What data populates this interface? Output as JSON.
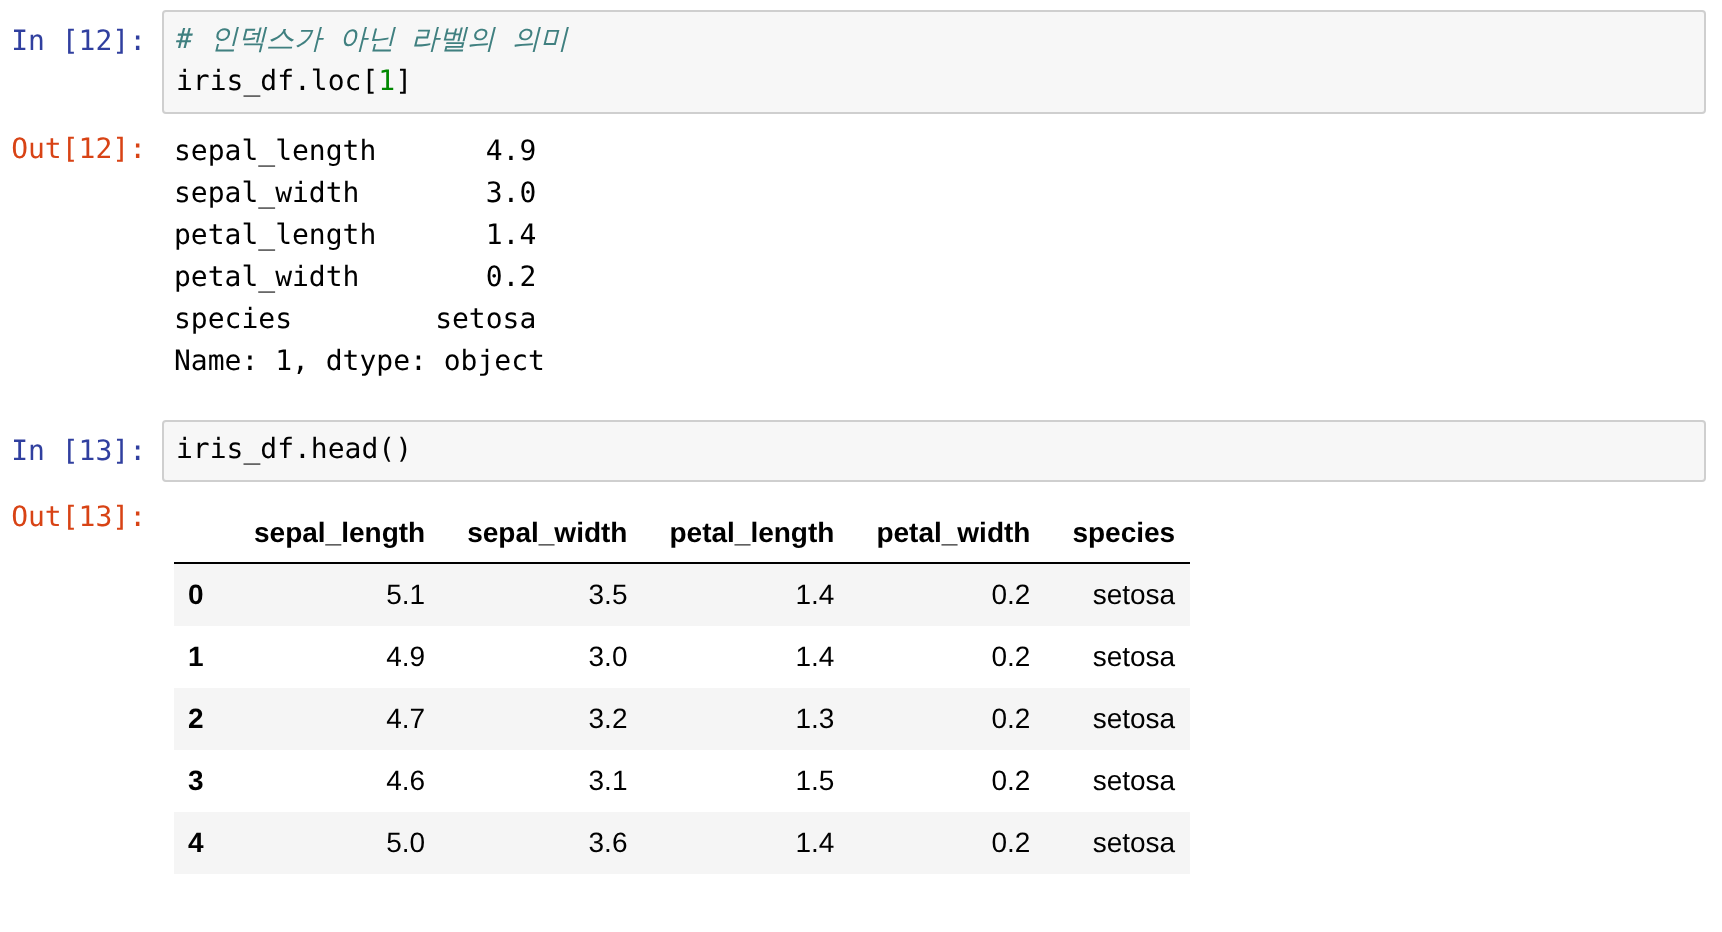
{
  "cells": [
    {
      "prompt_in": "In [12]:",
      "code": [
        [
          {
            "text": "# 인덱스가 아닌 라벨의 의미",
            "kind": "comment"
          }
        ],
        [
          {
            "text": "iris_df.loc[",
            "kind": "plain"
          },
          {
            "text": "1",
            "kind": "number"
          },
          {
            "text": "]",
            "kind": "plain"
          }
        ]
      ],
      "prompt_out": "Out[12]:",
      "output": {
        "kind": "series",
        "rows": [
          {
            "label": "sepal_length",
            "value": "4.9"
          },
          {
            "label": "sepal_width",
            "value": "3.0"
          },
          {
            "label": "petal_length",
            "value": "1.4"
          },
          {
            "label": "petal_width",
            "value": "0.2"
          },
          {
            "label": "species",
            "value": "setosa"
          }
        ],
        "footer": "Name: 1, dtype: object"
      }
    },
    {
      "prompt_in": "In [13]:",
      "code": [
        [
          {
            "text": "iris_df.head()",
            "kind": "plain"
          }
        ]
      ],
      "prompt_out": "Out[13]:",
      "output": {
        "kind": "table",
        "columns": [
          "sepal_length",
          "sepal_width",
          "petal_length",
          "petal_width",
          "species"
        ],
        "rows": [
          {
            "index": "0",
            "values": [
              "5.1",
              "3.5",
              "1.4",
              "0.2",
              "setosa"
            ]
          },
          {
            "index": "1",
            "values": [
              "4.9",
              "3.0",
              "1.4",
              "0.2",
              "setosa"
            ]
          },
          {
            "index": "2",
            "values": [
              "4.7",
              "3.2",
              "1.3",
              "0.2",
              "setosa"
            ]
          },
          {
            "index": "3",
            "values": [
              "4.6",
              "3.1",
              "1.5",
              "0.2",
              "setosa"
            ]
          },
          {
            "index": "4",
            "values": [
              "5.0",
              "3.6",
              "1.4",
              "0.2",
              "setosa"
            ]
          }
        ]
      }
    }
  ]
}
